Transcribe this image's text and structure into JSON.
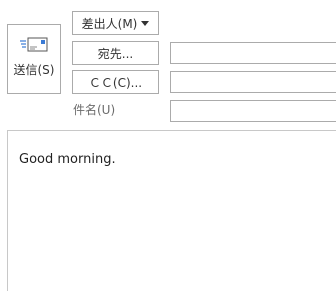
{
  "compose": {
    "send": {
      "label": "送信(S)",
      "icon": "send-envelope-icon"
    },
    "from_button": {
      "label": "差出人(M)",
      "icon": "dropdown-caret-icon"
    },
    "to_button": {
      "label": "宛先..."
    },
    "cc_button": {
      "label": "ＣＣ(C)..."
    },
    "subject": {
      "label": "件名(U)"
    },
    "fields": {
      "to": "",
      "cc": "",
      "subject": ""
    },
    "body": {
      "text": "Good morning."
    },
    "colors": {
      "border": "#ababab",
      "text": "#333333",
      "icon_blue": "#1f6fd1"
    }
  }
}
